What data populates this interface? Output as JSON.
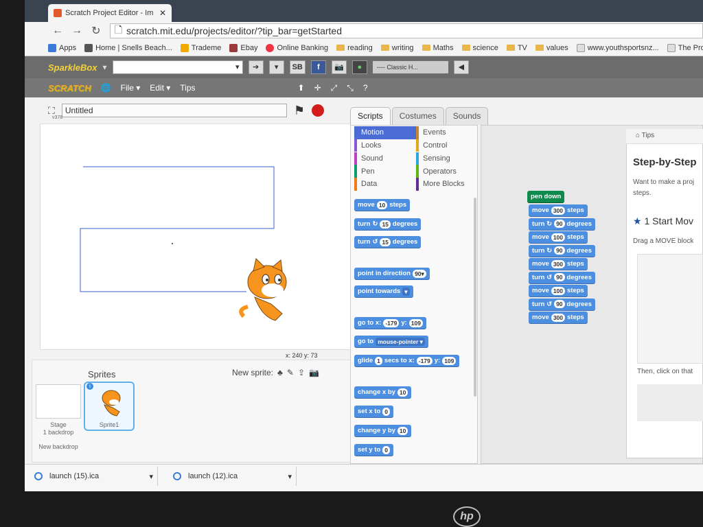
{
  "browser": {
    "tab_title": "Scratch Project Editor - Im",
    "url": "scratch.mit.edu/projects/editor/?tip_bar=getStarted",
    "bookmarks": [
      "Apps",
      "Home | Snells Beach...",
      "Trademe",
      "Ebay",
      "Online Banking",
      "reading",
      "writing",
      "Maths",
      "science",
      "TV",
      "values",
      "www.youthsportsnz...",
      "The Pro Tr"
    ]
  },
  "toolbar": {
    "sparklebox": "SparkleBox",
    "sb": "SB",
    "classic": "---- Classic H..."
  },
  "scratch": {
    "logo": "SCRATCH",
    "menu": [
      "File ▾",
      "Edit ▾",
      "Tips"
    ],
    "project_title": "Untitled",
    "version": "v378",
    "coords": "x: 240  y: 73",
    "sprites_header": "Sprites",
    "new_sprite": "New sprite:",
    "stage_label": "Stage",
    "stage_backdrops": "1 backdrop",
    "new_backdrop": "New backdrop",
    "sprite_name": "Sprite1",
    "tabs": [
      "Scripts",
      "Costumes",
      "Sounds"
    ],
    "categories": [
      {
        "name": "Motion",
        "color": "#4a6cd4"
      },
      {
        "name": "Events",
        "color": "#c88330"
      },
      {
        "name": "Looks",
        "color": "#8a55d7"
      },
      {
        "name": "Control",
        "color": "#e1a91a"
      },
      {
        "name": "Sound",
        "color": "#bb42c3"
      },
      {
        "name": "Sensing",
        "color": "#2ca5e2"
      },
      {
        "name": "Pen",
        "color": "#0e9a6c"
      },
      {
        "name": "Operators",
        "color": "#5cb712"
      },
      {
        "name": "Data",
        "color": "#ee7d16"
      },
      {
        "name": "More Blocks",
        "color": "#632d99"
      }
    ],
    "palette": {
      "move": "move",
      "steps": "steps",
      "move_val": "10",
      "turn": "turn",
      "degrees": "degrees",
      "turn_val": "15",
      "point_dir": "point in direction",
      "dir_val": "90▾",
      "point_towards": "point towards",
      "goto": "go to x:",
      "gx": "-179",
      "gy_lbl": "y:",
      "gy": "109",
      "goto2": "go to",
      "mouse": "mouse-pointer ▾",
      "glide": "glide",
      "secs": "secs to x:",
      "glide_s": "1",
      "change_x": "change x by",
      "cx": "10",
      "set_x": "set x to",
      "sx": "0",
      "change_y": "change y by",
      "cy": "10",
      "set_y": "set y to",
      "sy": "0"
    },
    "script": {
      "pen_down": "pen down",
      "lines": [
        {
          "a": "move",
          "v": "300",
          "b": "steps"
        },
        {
          "a": "turn ↻",
          "v": "90",
          "b": "degrees"
        },
        {
          "a": "move",
          "v": "100",
          "b": "steps"
        },
        {
          "a": "turn ↻",
          "v": "90",
          "b": "degrees"
        },
        {
          "a": "move",
          "v": "300",
          "b": "steps"
        },
        {
          "a": "turn ↺",
          "v": "90",
          "b": "degrees"
        },
        {
          "a": "move",
          "v": "100",
          "b": "steps"
        },
        {
          "a": "turn ↺",
          "v": "90",
          "b": "degrees"
        },
        {
          "a": "move",
          "v": "300",
          "b": "steps"
        }
      ]
    },
    "tips": {
      "header": "Tips",
      "title": "Step-by-Step",
      "desc": "Want to make a proj steps.",
      "step1": "1 Start Mov",
      "drag": "Drag a MOVE block",
      "then": "Then, click on that"
    }
  },
  "downloads": [
    "launch (15).ica",
    "launch (12).ica"
  ],
  "brand": "hp"
}
